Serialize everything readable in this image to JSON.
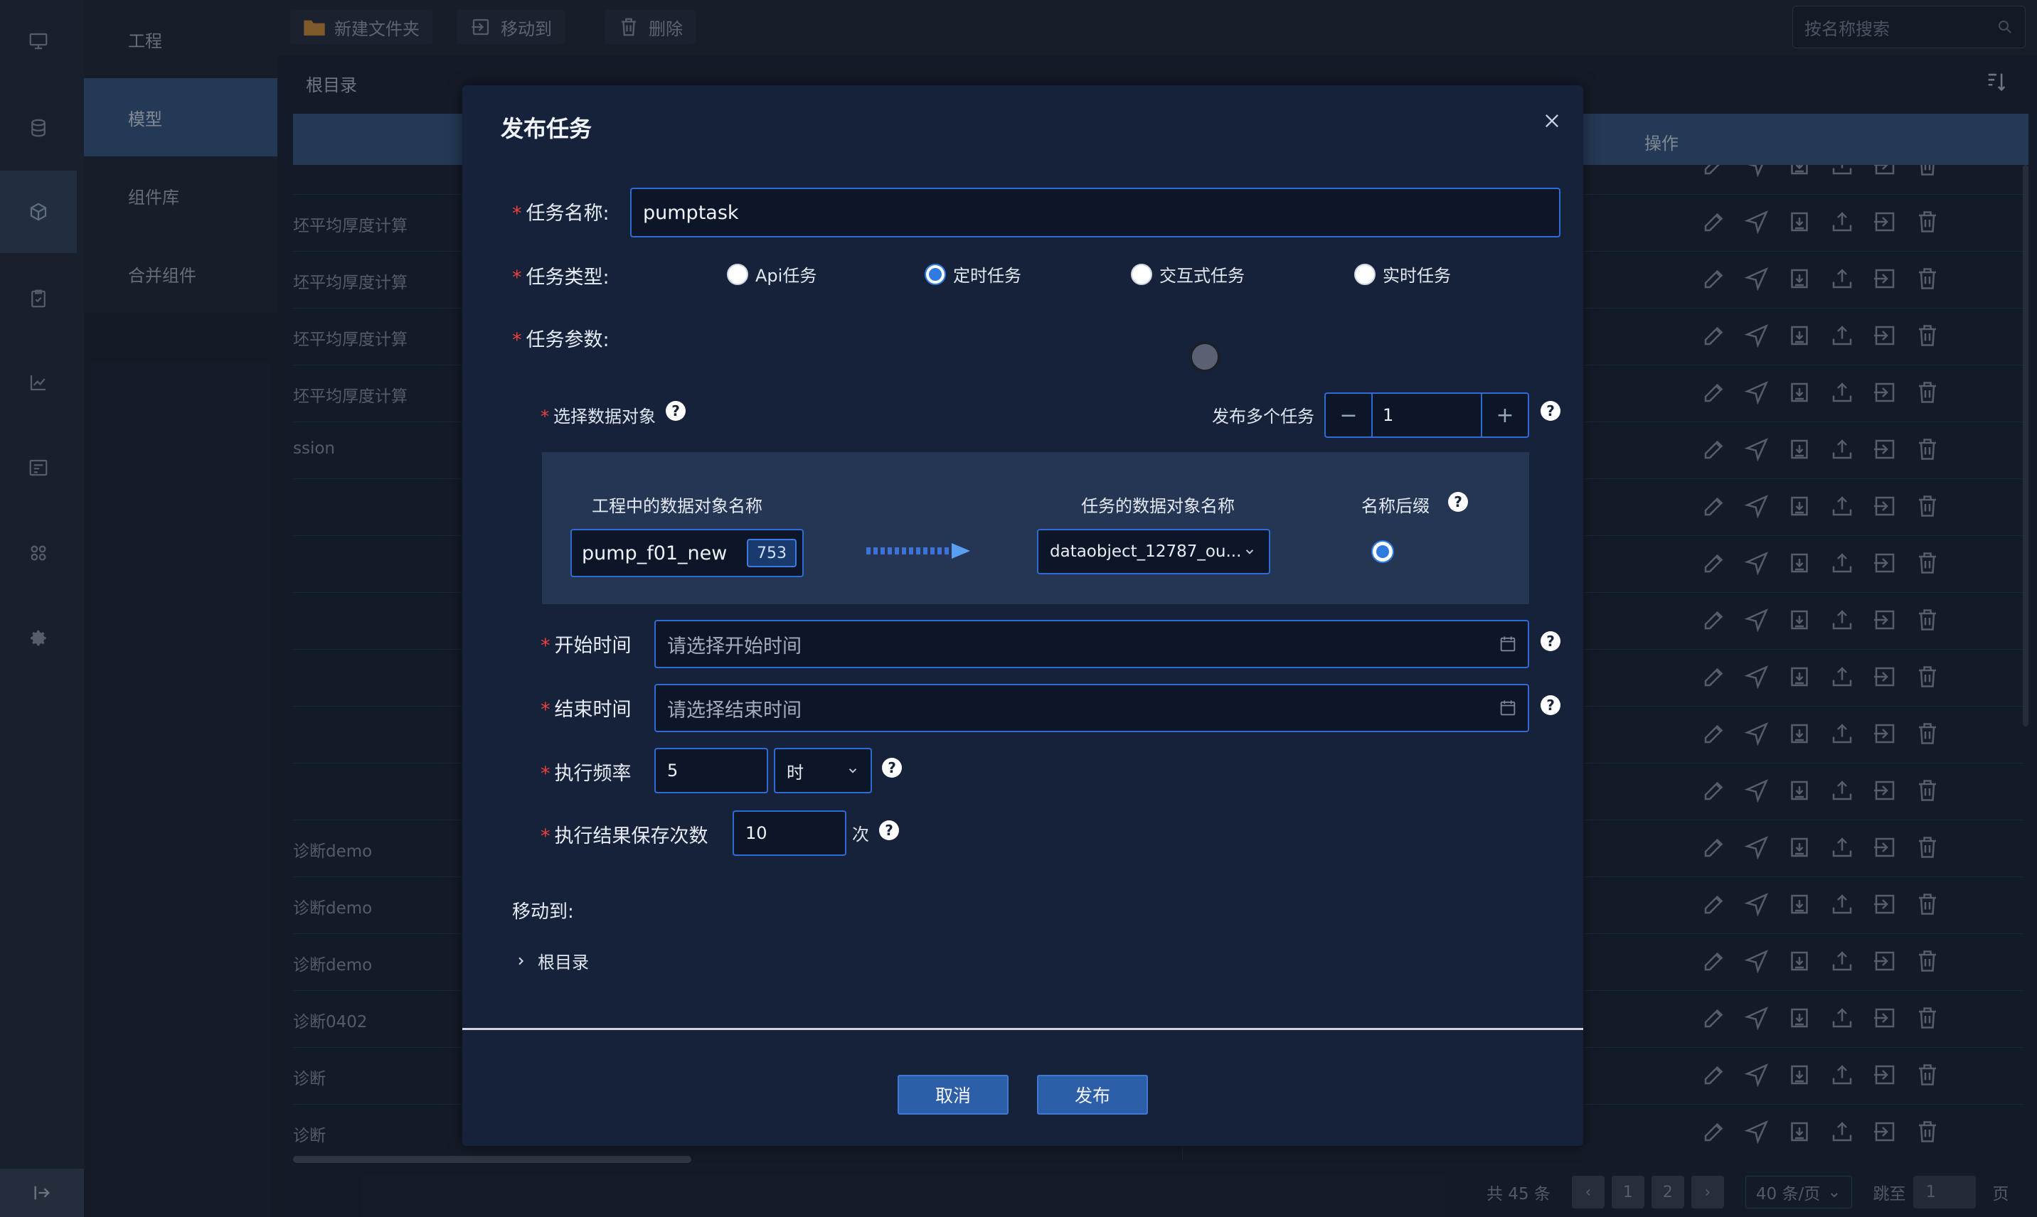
{
  "toolbar": {
    "new_folder": "新建文件夹",
    "move_to": "移动到",
    "delete": "删除",
    "search_placeholder": "按名称搜索"
  },
  "subnav": {
    "items": [
      "工程",
      "模型",
      "组件库",
      "合并组件"
    ]
  },
  "breadcrumb": "根目录",
  "table": {
    "actions_header": "操作",
    "rows": [
      "坯平均厚度计算",
      "坯平均厚度计算",
      "坯平均厚度计算",
      "坯平均厚度计算",
      "ssion",
      "",
      "",
      "",
      "",
      "",
      "",
      "诊断demo",
      "诊断demo",
      "诊断demo",
      "诊断0402",
      "诊断",
      "诊断"
    ]
  },
  "pagination": {
    "total": "共 45 条",
    "pages": [
      "1",
      "2"
    ],
    "page_size": "40 条/页",
    "jump_label": "跳至",
    "jump_value": "1",
    "page_suffix": "页"
  },
  "dialog": {
    "title": "发布任务",
    "task_name_label": "任务名称:",
    "task_name_value": "pumptask",
    "task_type_label": "任务类型:",
    "task_types": [
      "Api任务",
      "定时任务",
      "交互式任务",
      "实时任务"
    ],
    "task_type_selected": "定时任务",
    "task_params_label": "任务参数:",
    "select_object_label": "选择数据对象",
    "multi_task_label": "发布多个任务",
    "multi_task_value": "1",
    "mapping": {
      "source_header": "工程中的数据对象名称",
      "target_header": "任务的数据对象名称",
      "suffix_header": "名称后缀",
      "source_value": "pump_f01_new",
      "source_badge": "753",
      "target_value": "dataobject_12787_ou..."
    },
    "start_time_label": "开始时间",
    "start_time_placeholder": "请选择开始时间",
    "end_time_label": "结束时间",
    "end_time_placeholder": "请选择结束时间",
    "frequency_label": "执行频率",
    "frequency_value": "5",
    "frequency_unit": "时",
    "save_count_label": "执行结果保存次数",
    "save_count_value": "10",
    "save_count_unit": "次",
    "move_to_label": "移动到:",
    "tree_root": "根目录",
    "cancel": "取消",
    "publish": "发布"
  },
  "colors": {
    "accent": "#2f6bd4",
    "required": "#e8413e",
    "dialog_bg": "#16223a"
  }
}
